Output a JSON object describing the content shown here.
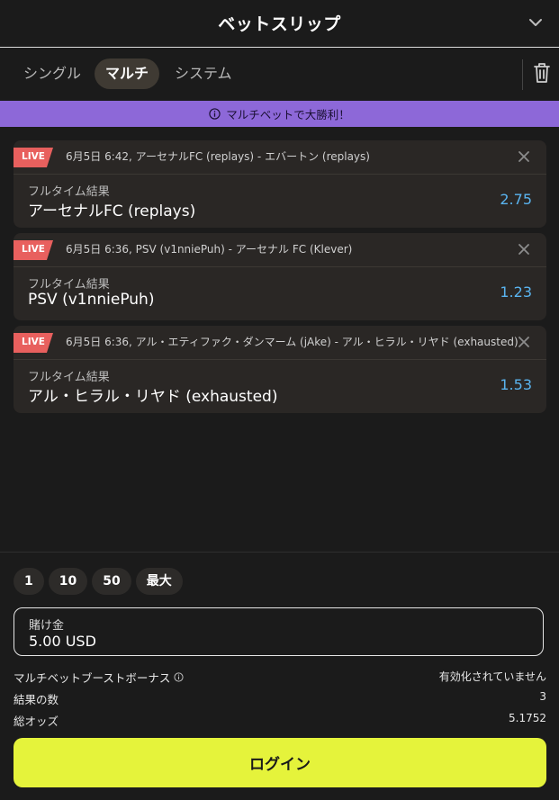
{
  "header": {
    "title": "ベットスリップ",
    "collapse_icon": "chevron-down-icon"
  },
  "tabs": [
    {
      "label": "シングル",
      "active": false
    },
    {
      "label": "マルチ",
      "active": true
    },
    {
      "label": "システム",
      "active": false
    }
  ],
  "trash_icon": "trash-icon",
  "promo": {
    "text": "マルチベットで大勝利！",
    "icon": "info-icon",
    "color": "#8d68d8"
  },
  "bets": [
    {
      "live": "LIVE",
      "event": "6月5日 6:42, アーセナルFC (replays) - エバートン (replays)",
      "market": "フルタイム結果",
      "selection": "アーセナルFC (replays)",
      "odds": "2.75"
    },
    {
      "live": "LIVE",
      "event": "6月5日 6:36, PSV (v1nniePuh) - アーセナル FC (Klever)",
      "market": "フルタイム結果",
      "selection": "PSV (v1nniePuh)",
      "odds": "1.23"
    },
    {
      "live": "LIVE",
      "event": "6月5日 6:36, アル・エティファク・ダンマーム (jAke) - アル・ヒラル・リヤド (exhausted)",
      "market": "フルタイム結果",
      "selection": "アル・ヒラル・リヤド (exhausted)",
      "odds": "1.53"
    }
  ],
  "quick_stakes": [
    "1",
    "10",
    "50",
    "最大"
  ],
  "stake": {
    "label": "賭け金",
    "value": "5.00 USD"
  },
  "summary": {
    "boost_label": "マルチベットブーストボーナス",
    "boost_value": "有効化されていません",
    "count_label": "結果の数",
    "count_value": "3",
    "odds_label": "総オッズ",
    "odds_value": "5.1752"
  },
  "login_button": "ログイン",
  "colors": {
    "accent": "#e5f33b",
    "live": "#e8605e",
    "odds": "#5ab4f0",
    "background": "#1b1b1b"
  }
}
